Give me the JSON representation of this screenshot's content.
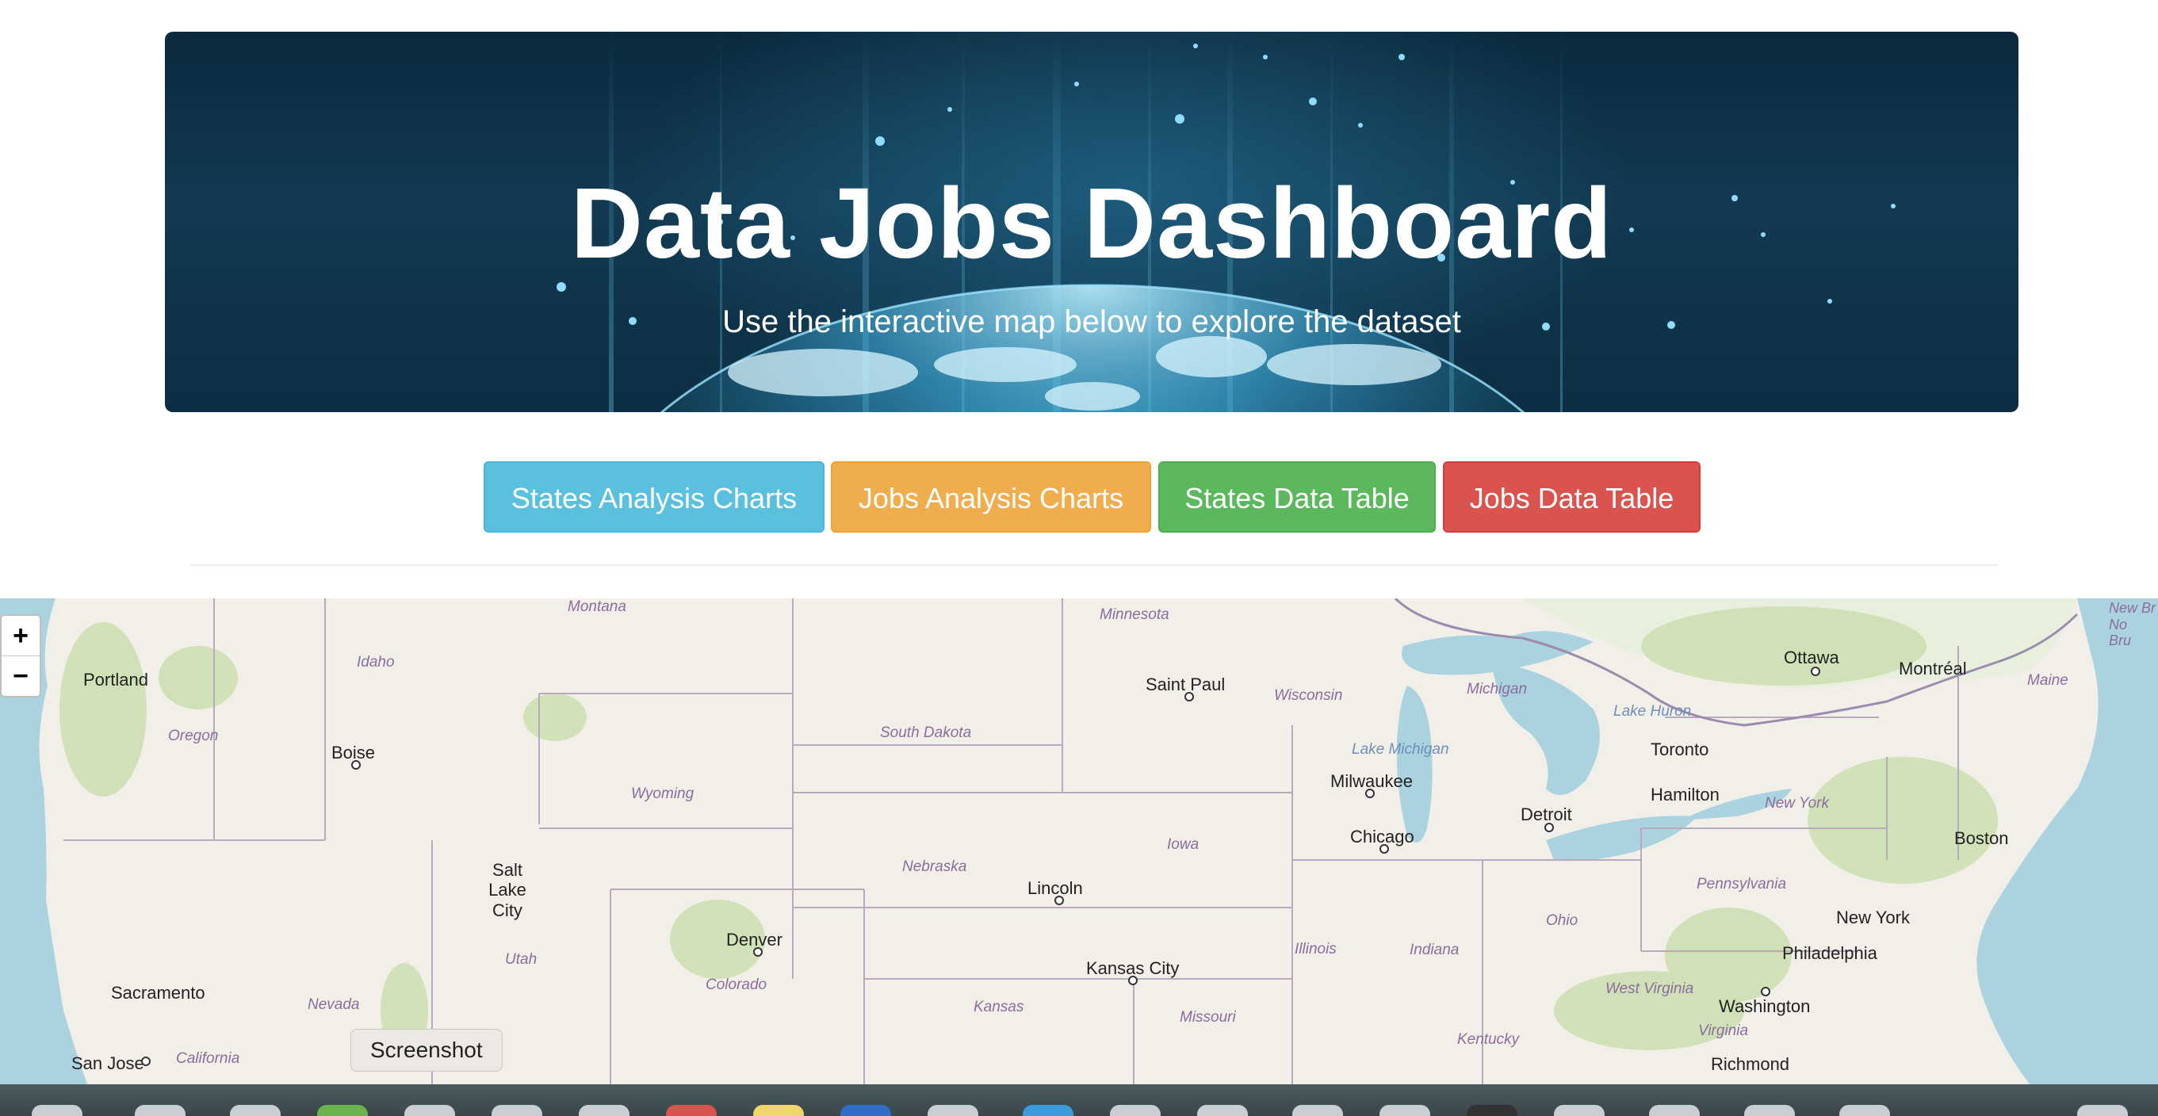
{
  "hero": {
    "title": "Data Jobs Dashboard",
    "subtitle": "Use the interactive map below to explore the dataset"
  },
  "nav_buttons": [
    {
      "label": "States Analysis Charts",
      "color": "#5bc0de"
    },
    {
      "label": "Jobs Analysis Charts",
      "color": "#f0ad4e"
    },
    {
      "label": "States Data Table",
      "color": "#5cb85c"
    },
    {
      "label": "Jobs Data Table",
      "color": "#d9534f"
    }
  ],
  "map": {
    "zoom_in": "+",
    "zoom_out": "−",
    "cities": [
      "Portland",
      "Boise",
      "Saint Paul",
      "Ottawa",
      "Montréal",
      "Toronto",
      "Hamilton",
      "Milwaukee",
      "Detroit",
      "Chicago",
      "Boston",
      "Salt Lake City",
      "Lincoln",
      "Denver",
      "New York",
      "Philadelphia",
      "Kansas City",
      "Washington",
      "Sacramento",
      "San Jose",
      "Richmond"
    ],
    "states": [
      "Montana",
      "Minnesota",
      "Idaho",
      "Oregon",
      "Wisconsin",
      "Michigan",
      "Maine",
      "South Dakota",
      "Wyoming",
      "New York",
      "Iowa",
      "Nebraska",
      "Pennsylvania",
      "Utah",
      "Ohio",
      "Illinois",
      "Indiana",
      "Colorado",
      "Kansas",
      "Nevada",
      "West Virginia",
      "Missouri",
      "Virginia",
      "Kentucky",
      "California",
      "New Br\nNo\nBru"
    ],
    "waters": [
      "Lake Huron",
      "Lake Michigan"
    ]
  },
  "tooltip": "Screenshot",
  "colors": {
    "hero_bg": "#0c2e42",
    "map_land": "#f2efe9",
    "map_water": "#aad3df",
    "map_forest": "#c8d7ab"
  }
}
